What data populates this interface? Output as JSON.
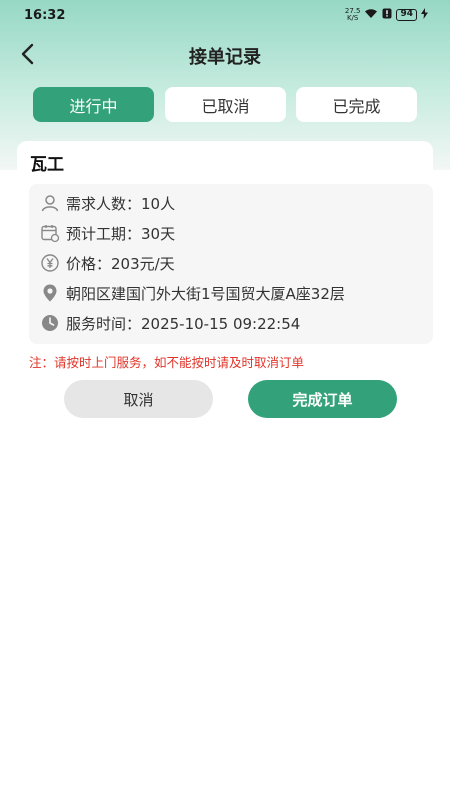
{
  "status_bar": {
    "time": "16:32",
    "net_speed_value": "27.5",
    "net_speed_unit": "K/S",
    "battery": "94"
  },
  "header": {
    "title": "接单记录"
  },
  "tabs": [
    {
      "label": "进行中",
      "active": true
    },
    {
      "label": "已取消",
      "active": false
    },
    {
      "label": "已完成",
      "active": false
    }
  ],
  "order": {
    "title": "瓦工",
    "rows": [
      {
        "icon": "person-icon",
        "text": "需求人数：10人"
      },
      {
        "icon": "calendar-icon",
        "text": "预计工期：30天"
      },
      {
        "icon": "yen-icon",
        "text": "价格：203元/天"
      },
      {
        "icon": "location-pin-icon",
        "text": "朝阳区建国门外大街1号国贸大厦A座32层"
      },
      {
        "icon": "clock-icon",
        "text": "服务时间：2025-10-15 09:22:54"
      }
    ],
    "notice": "注：请按时上门服务，如不能按时请及时取消订单",
    "cancel_label": "取消",
    "complete_label": "完成订单"
  },
  "colors": {
    "accent": "#33a27b",
    "notice": "#e0342a"
  }
}
